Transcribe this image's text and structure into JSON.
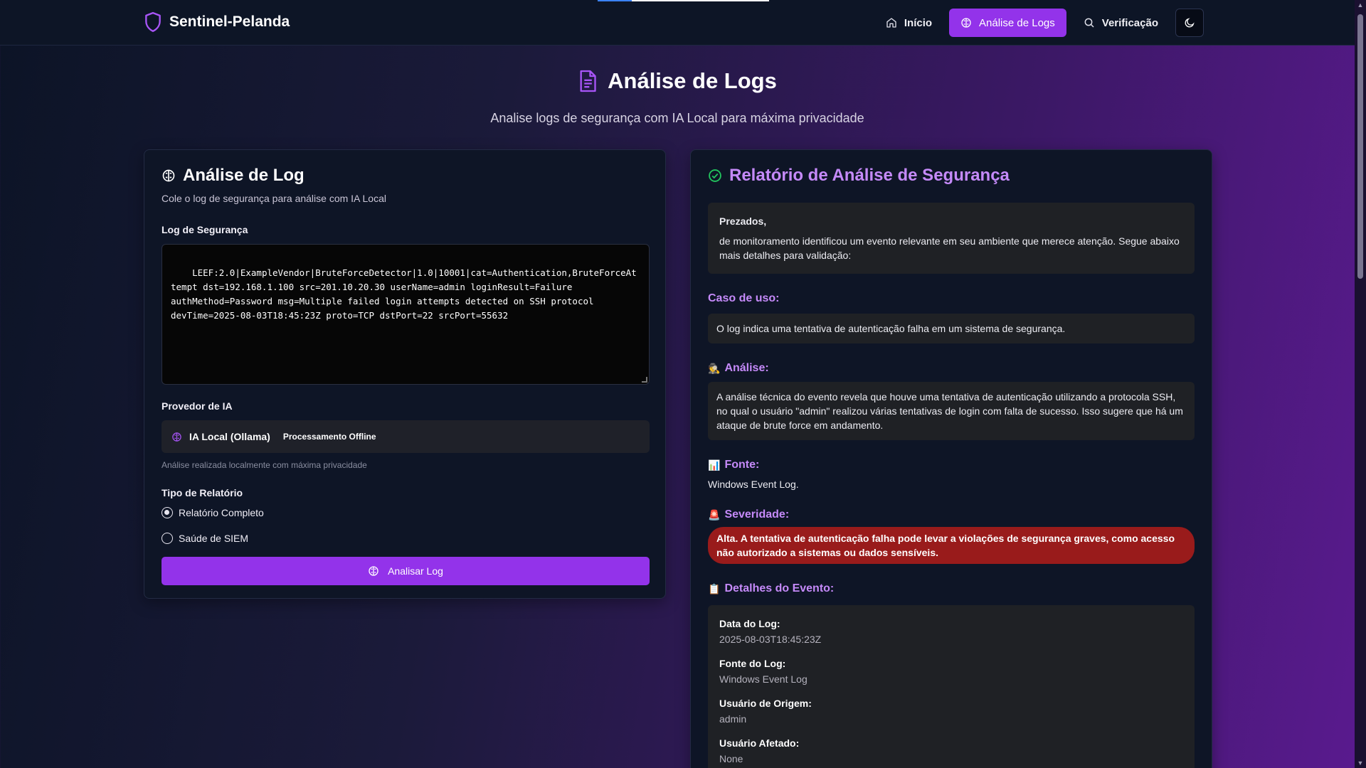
{
  "nav": {
    "brand": "Sentinel-Pelanda",
    "items": [
      {
        "label": "Início",
        "icon": "home-icon"
      },
      {
        "label": "Análise de Logs",
        "icon": "brain-icon"
      },
      {
        "label": "Verificação",
        "icon": "search-icon"
      }
    ],
    "theme_icon": "moon-icon"
  },
  "hero": {
    "title": "Análise de Logs",
    "subtitle": "Analise logs de segurança com IA Local para máxima privacidade"
  },
  "form": {
    "title": "Análise de Log",
    "description": "Cole o log de segurança para análise com IA Local",
    "log_label": "Log de Segurança",
    "log_value": "LEEF:2.0|ExampleVendor|BruteForceDetector|1.0|10001|cat=Authentication,BruteForceAttempt dst=192.168.1.100 src=201.10.20.30 userName=admin loginResult=Failure\nauthMethod=Password msg=Multiple failed login attempts detected on SSH protocol\ndevTime=2025-08-03T18:45:23Z proto=TCP dstPort=22 srcPort=55632",
    "provider_label": "Provedor de IA",
    "provider_name": "IA Local (Ollama)",
    "provider_badge": "Processamento Offline",
    "provider_hint": "Análise realizada localmente com máxima privacidade",
    "report_type_label": "Tipo de Relatório",
    "report_types": [
      {
        "label": "Relatório Completo",
        "checked": true
      },
      {
        "label": "Saúde de SIEM",
        "checked": false
      }
    ],
    "submit_label": "Analisar Log"
  },
  "report": {
    "title": "Relatório de Análise de Segurança",
    "greeting": "Prezados,",
    "intro": "de monitoramento identificou um evento relevante em seu ambiente que merece atenção. Segue abaixo mais detalhes para validação:",
    "use_case_title": "Caso de uso:",
    "use_case_text": "O log indica uma tentativa de autenticação falha em um sistema de segurança.",
    "analysis_emoji": "🕵️",
    "analysis_title": "Análise:",
    "analysis_text": "A análise técnica do evento revela que houve uma tentativa de autenticação utilizando a protocola SSH, no qual o usuário \"admin\" realizou várias tentativas de login com falta de sucesso. Isso sugere que há um ataque de brute force em andamento.",
    "source_emoji": "📊",
    "source_title": "Fonte:",
    "source_text": "Windows Event Log.",
    "severity_emoji": "🚨",
    "severity_title": "Severidade:",
    "severity_text": "Alta. A tentativa de autenticação falha pode levar a violações de segurança graves, como acesso não autorizado a sistemas ou dados sensíveis.",
    "details_emoji": "📋",
    "details_title": "Detalhes do Evento:",
    "details": [
      {
        "label": "Data do Log:",
        "value": "2025-08-03T18:45:23Z"
      },
      {
        "label": "Fonte do Log:",
        "value": "Windows Event Log"
      },
      {
        "label": "Usuário de Origem:",
        "value": "admin"
      },
      {
        "label": "Usuário Afetado:",
        "value": "None"
      }
    ]
  },
  "colors": {
    "accent": "#9333ea",
    "report_heading": "#c58af9",
    "severity_bg": "#991b1b",
    "success_icon": "#22c55e"
  }
}
